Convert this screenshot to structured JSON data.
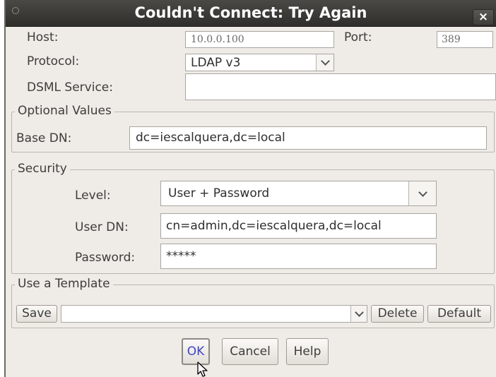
{
  "window": {
    "title": "Couldn't Connect: Try Again",
    "close_glyph": "×"
  },
  "connection": {
    "host_label": "Host:",
    "host_value": "10.0.0.100",
    "port_label": "Port:",
    "port_value": "389",
    "protocol_label": "Protocol:",
    "protocol_value": "LDAP v3",
    "dsml_label": "DSML Service:",
    "dsml_value": ""
  },
  "optional": {
    "title": "Optional Values",
    "base_dn_label": "Base DN:",
    "base_dn_value": "dc=iescalquera,dc=local"
  },
  "security": {
    "title": "Security",
    "level_label": "Level:",
    "level_value": "User + Password",
    "user_dn_label": "User DN:",
    "user_dn_value": "cn=admin,dc=iescalquera,dc=local",
    "password_label": "Password:",
    "password_value": "*****"
  },
  "template": {
    "title": "Use a Template",
    "save_label": "Save",
    "selected_value": "",
    "delete_label": "Delete",
    "default_label": "Default"
  },
  "buttons": {
    "ok_label": "OK",
    "cancel_label": "Cancel",
    "help_label": "Help"
  }
}
